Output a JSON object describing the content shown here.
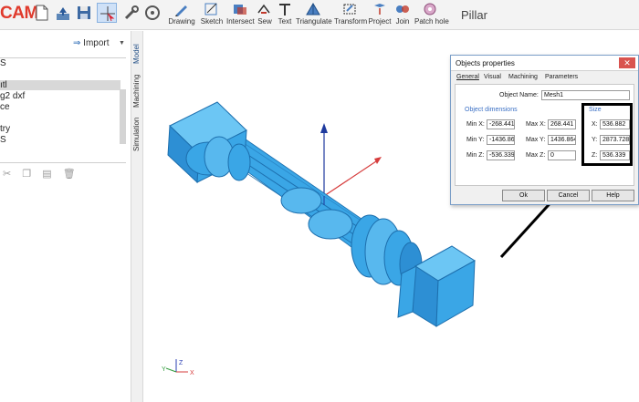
{
  "app": {
    "brand": "CAM",
    "project_name": "Pillar"
  },
  "toolbar": {
    "file_icons": [
      "new-file-icon",
      "open-file-icon",
      "save-icon",
      "select-tool-icon",
      "tools-icon",
      "measure-icon"
    ],
    "tools": [
      {
        "label": "Drawing",
        "icon": "drawing-icon"
      },
      {
        "label": "Sketch",
        "icon": "sketch-icon"
      },
      {
        "label": "Intersect",
        "icon": "intersect-icon"
      },
      {
        "label": "Sew",
        "icon": "sew-icon"
      },
      {
        "label": "Text",
        "icon": "text-icon"
      },
      {
        "label": "Triangulate",
        "icon": "triangulate-icon"
      },
      {
        "label": "Transform",
        "icon": "transform-icon"
      },
      {
        "label": "Project",
        "icon": "project-icon"
      },
      {
        "label": "Join",
        "icon": "join-icon"
      },
      {
        "label": "Patch hole",
        "icon": "patch-hole-icon"
      }
    ]
  },
  "left_panel": {
    "import_label": "Import",
    "tree_items": [
      "ıtl",
      "g2 dxf",
      "ce",
      "",
      "try",
      "S"
    ],
    "selected_index": 0,
    "actions": [
      "cut-icon",
      "copy-icon",
      "paste-icon",
      "delete-icon"
    ]
  },
  "side_tabs": [
    "Model",
    "Machining",
    "Simulation"
  ],
  "viewport": {
    "model": "pillar-mesh",
    "mesh_color": "#3aa6e6",
    "axis_labels": {
      "x": "X",
      "y": "Y",
      "z": "Z"
    }
  },
  "dialog": {
    "title": "Objects properties",
    "close_label": "✕",
    "tabs": [
      "General",
      "Visual",
      "Machining",
      "Parameters"
    ],
    "active_tab": 0,
    "object_name_label": "Object Name:",
    "object_name": "Mesh1",
    "dimensions_title": "Object dimensions",
    "size_title": "Size",
    "min_x_label": "Min X:",
    "min_x": "-268.441",
    "min_y_label": "Min Y:",
    "min_y": "-1436.864",
    "min_z_label": "Min Z:",
    "min_z": "-536.339",
    "max_x_label": "Max X:",
    "max_x": "268.441",
    "max_y_label": "Max Y:",
    "max_y": "1436.864",
    "max_z_label": "Max Z:",
    "max_z": "0",
    "size_x_label": "X:",
    "size_x": "536.882",
    "size_y_label": "Y:",
    "size_y": "2873.728",
    "size_z_label": "Z:",
    "size_z": "536.339",
    "ok_label": "Ok",
    "cancel_label": "Cancel",
    "help_label": "Help"
  },
  "colors": {
    "brand": "#e03a2c",
    "mesh": "#3aa6e6",
    "section_title": "#3a6fc4",
    "highlight_frame": "#000000"
  }
}
